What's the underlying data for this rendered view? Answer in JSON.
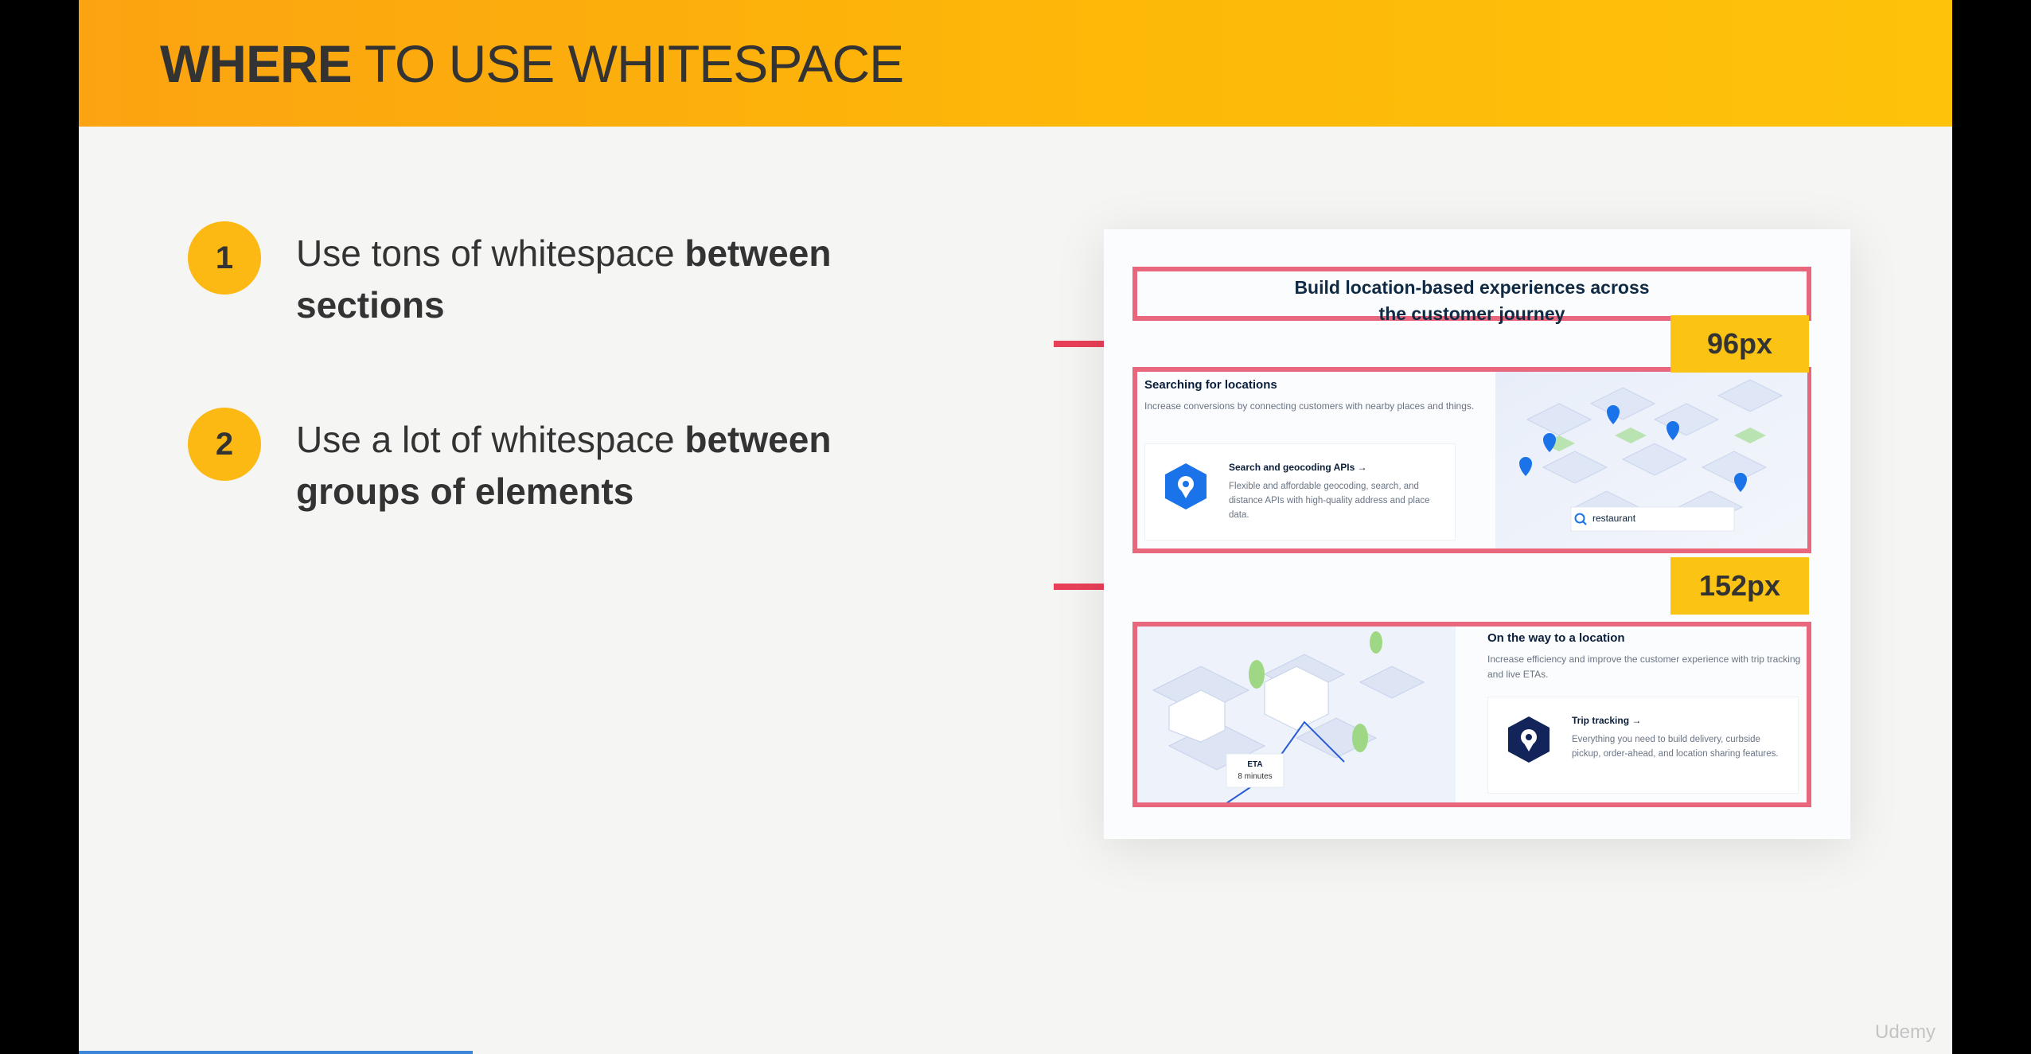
{
  "slide": {
    "title_bold": "WHERE",
    "title_rest": "TO USE WHITESPACE",
    "points": [
      {
        "number": "1",
        "text": "Use tons of whitespace ",
        "bold": "between sections"
      },
      {
        "number": "2",
        "text": "Use a lot of whitespace ",
        "bold": "between groups of elements"
      }
    ],
    "watermark": "Udemy"
  },
  "screenshot": {
    "heading_line1": "Build location-based experiences across",
    "heading_line2": "the customer journey",
    "spacing_tags": [
      "96px",
      "152px"
    ],
    "section1": {
      "title": "Searching for locations",
      "desc": "Increase conversions by connecting customers with nearby places and things.",
      "card_title": "Search and geocoding APIs →",
      "card_desc": "Flexible and affordable geocoding, search, and distance APIs with high-quality address and place data.",
      "search_value": "restaurant"
    },
    "section2": {
      "title": "On the way to a location",
      "desc": "Increase efficiency and improve the customer experience with trip tracking and live ETAs.",
      "card_title": "Trip tracking →",
      "card_desc": "Everything you need to build delivery, curbside pickup, order-ahead, and location sharing features.",
      "eta_label": "ETA",
      "eta_value": "8 minutes"
    }
  },
  "colors": {
    "header_from": "#fca311",
    "header_to": "#fec20a",
    "badge": "#fcb813",
    "outline": "#e8677c",
    "arrow": "#e94059",
    "tag": "#fbc313"
  },
  "icons": [
    "arrow-right-icon",
    "location-pin-icon",
    "search-icon",
    "map-illustration-icon",
    "city-illustration-icon"
  ]
}
